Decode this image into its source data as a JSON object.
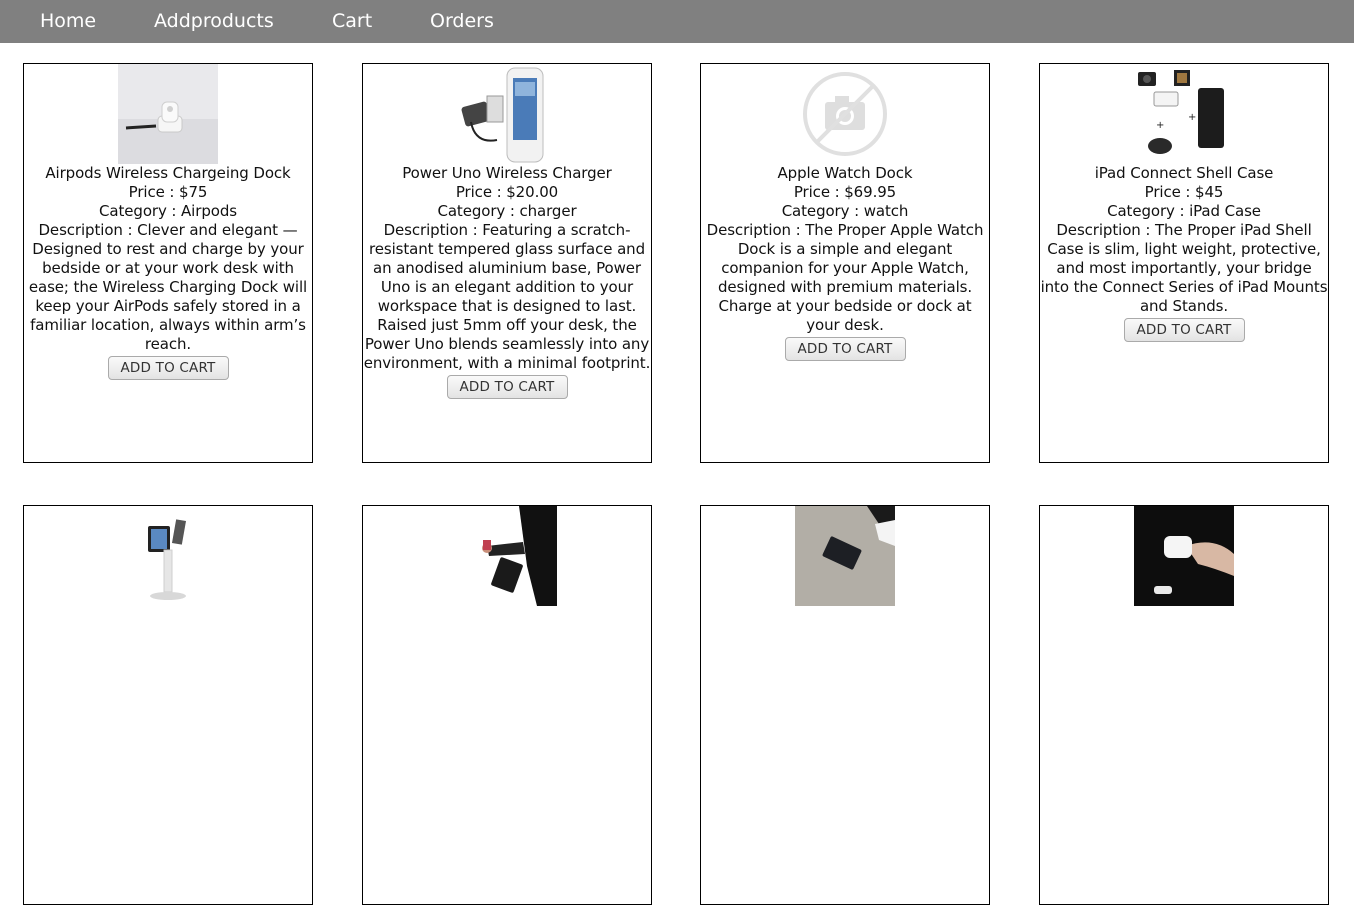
{
  "nav": {
    "home": "Home",
    "addproducts": "Addproducts",
    "cart": "Cart",
    "orders": "Orders"
  },
  "products": [
    {
      "name": "Airpods Wireless Chargeing Dock",
      "price": "Price : $75",
      "category": "Category : Airpods",
      "description": "Description : Clever and elegant — Designed to rest and charge by your bedside or at your work desk with ease; the Wireless Charging Dock will keep your AirPods safely stored in a familiar location, always within arm’s reach.",
      "button": "ADD TO CART"
    },
    {
      "name": "Power Uno Wireless Charger",
      "price": "Price : $20.00",
      "category": "Category : charger",
      "description": "Description : Featuring a scratch-resistant tempered glass surface and an anodised aluminium base, Power Uno is an elegant addition to your workspace that is designed to last. Raised just 5mm off your desk, the Power Uno blends seamlessly into any environment, with a minimal footprint.",
      "button": "ADD TO CART"
    },
    {
      "name": "Apple Watch Dock",
      "price": "Price : $69.95",
      "category": "Category : watch",
      "description": "Description : The Proper Apple Watch Dock is a simple and elegant companion for your Apple Watch, designed with premium materials. Charge at your bedside or dock at your desk.",
      "button": "ADD TO CART"
    },
    {
      "name": "iPad Connect Shell Case",
      "price": "Price : $45",
      "category": "Category : iPad Case",
      "description": "Description : The Proper iPad Shell Case is slim, light weight, protective, and most importantly, your bridge into the Connect Series of iPad Mounts and Stands.",
      "button": "ADD TO CART"
    }
  ]
}
